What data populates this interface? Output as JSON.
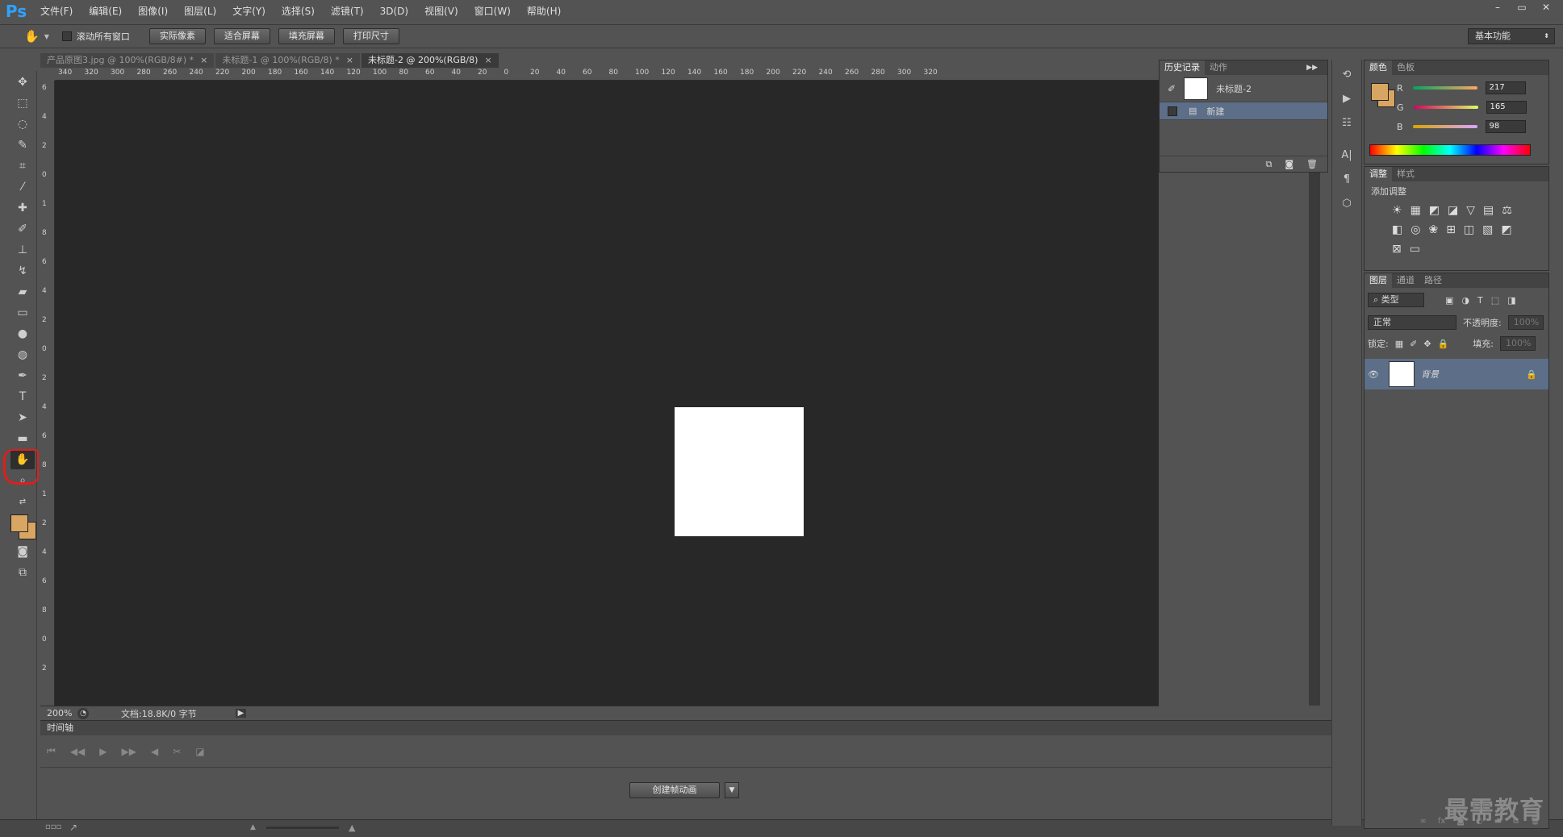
{
  "app": {
    "logo": "Ps",
    "watermark": "最需教育"
  },
  "menu": [
    "文件(F)",
    "编辑(E)",
    "图像(I)",
    "图层(L)",
    "文字(Y)",
    "选择(S)",
    "滤镜(T)",
    "3D(D)",
    "视图(V)",
    "窗口(W)",
    "帮助(H)"
  ],
  "window_controls": {
    "minimize": "–",
    "restore": "▭",
    "close": "✕"
  },
  "options": {
    "scroll_all_label": "滚动所有窗口",
    "btn_actual": "实际像素",
    "btn_fit": "适合屏幕",
    "btn_fill": "填充屏幕",
    "btn_print": "打印尺寸",
    "workspace": "基本功能"
  },
  "tabs": [
    {
      "label": "产品原图3.jpg @ 100%(RGB/8#) *",
      "active": false
    },
    {
      "label": "未标题-1 @ 100%(RGB/8) *",
      "active": false
    },
    {
      "label": "未标题-2 @ 200%(RGB/8)",
      "active": true
    }
  ],
  "ruler_h": [
    "340",
    "320",
    "300",
    "280",
    "260",
    "240",
    "220",
    "200",
    "180",
    "160",
    "140",
    "120",
    "100",
    "80",
    "60",
    "40",
    "20",
    "0",
    "20",
    "40",
    "60",
    "80",
    "100",
    "120",
    "140",
    "160",
    "180",
    "200",
    "220",
    "240",
    "260",
    "280",
    "300",
    "320"
  ],
  "ruler_v": [
    "6",
    "4",
    "2",
    "0",
    "1",
    "8",
    "6",
    "4",
    "2",
    "0",
    "2",
    "4",
    "6",
    "8",
    "1",
    "2",
    "4",
    "6",
    "8",
    "0",
    "2"
  ],
  "status": {
    "zoom": "200%",
    "doc": "文档:18.8K/0 字节"
  },
  "timeline": {
    "title": "时间轴",
    "create_btn": "创建帧动画"
  },
  "history": {
    "tabs": [
      "历史记录",
      "动作"
    ],
    "snapshot": "未标题-2",
    "items": [
      "新建"
    ]
  },
  "color_panel": {
    "tabs": [
      "颜色",
      "色板"
    ],
    "channels": [
      {
        "name": "R",
        "value": "217"
      },
      {
        "name": "G",
        "value": "165"
      },
      {
        "name": "B",
        "value": "98"
      }
    ],
    "foreground": "#d9a562"
  },
  "adjust_panel": {
    "tabs": [
      "调整",
      "样式"
    ],
    "title": "添加调整"
  },
  "layers_panel": {
    "tabs": [
      "图层",
      "通道",
      "路径"
    ],
    "filter": "类型",
    "blend": "正常",
    "opacity_label": "不透明度:",
    "opacity": "100%",
    "lock_label": "锁定:",
    "fill_label": "填充:",
    "fill": "100%",
    "layers": [
      {
        "name": "背景"
      }
    ]
  }
}
